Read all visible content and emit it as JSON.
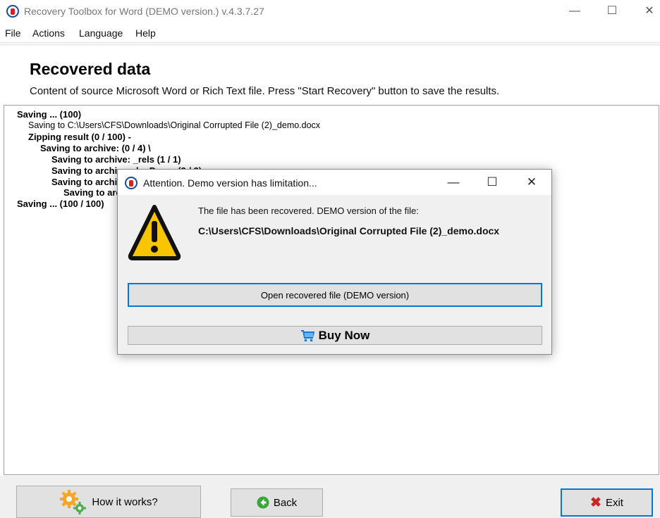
{
  "window": {
    "title": "Recovery Toolbox for Word (DEMO version.) v.4.3.7.27",
    "minimize": "—",
    "maximize": "☐",
    "close": "✕"
  },
  "menu": {
    "items": [
      "File",
      "Actions",
      "Language",
      "Help"
    ]
  },
  "header": {
    "title": "Recovered data",
    "subtitle": "Content of source Microsoft Word or Rich Text file. Press \"Start Recovery\" button to save the results."
  },
  "log": {
    "lines": [
      {
        "text": "Saving ... (100)",
        "bold": true
      },
      {
        "text": "Saving to C:\\Users\\CFS\\Downloads\\Original Corrupted File (2)_demo.docx",
        "bold": false
      },
      {
        "text": "Zipping result (0 / 100) -",
        "bold": true
      },
      {
        "text": "Saving to archive:  (0 / 4) \\",
        "bold": true
      },
      {
        "text": "Saving to archive: _rels (1 / 1)",
        "bold": true
      },
      {
        "text": "Saving to archive: docProps (2 / 2)",
        "bold": true
      },
      {
        "text": "Saving to archive: word (3 / 3)",
        "bold": true
      },
      {
        "text": "Saving to archive: (4 / 4)",
        "bold": true
      },
      {
        "text": "Saving ... (100 / 100)",
        "bold": true
      }
    ]
  },
  "footer": {
    "how_it_works": "How it works?",
    "back": "Back",
    "exit": "Exit"
  },
  "dialog": {
    "title": "Attention. Demo version has limitation...",
    "message": "The file has been recovered. DEMO version of the file:",
    "path": "C:\\Users\\CFS\\Downloads\\Original Corrupted File (2)_demo.docx",
    "open_button": "Open recovered file (DEMO version)",
    "buy_button": "Buy Now",
    "minimize": "—",
    "maximize": "☐",
    "close": "✕"
  },
  "colors": {
    "accent": "#0078d7",
    "warning": "#f9c400",
    "exit_x": "#c62828"
  }
}
